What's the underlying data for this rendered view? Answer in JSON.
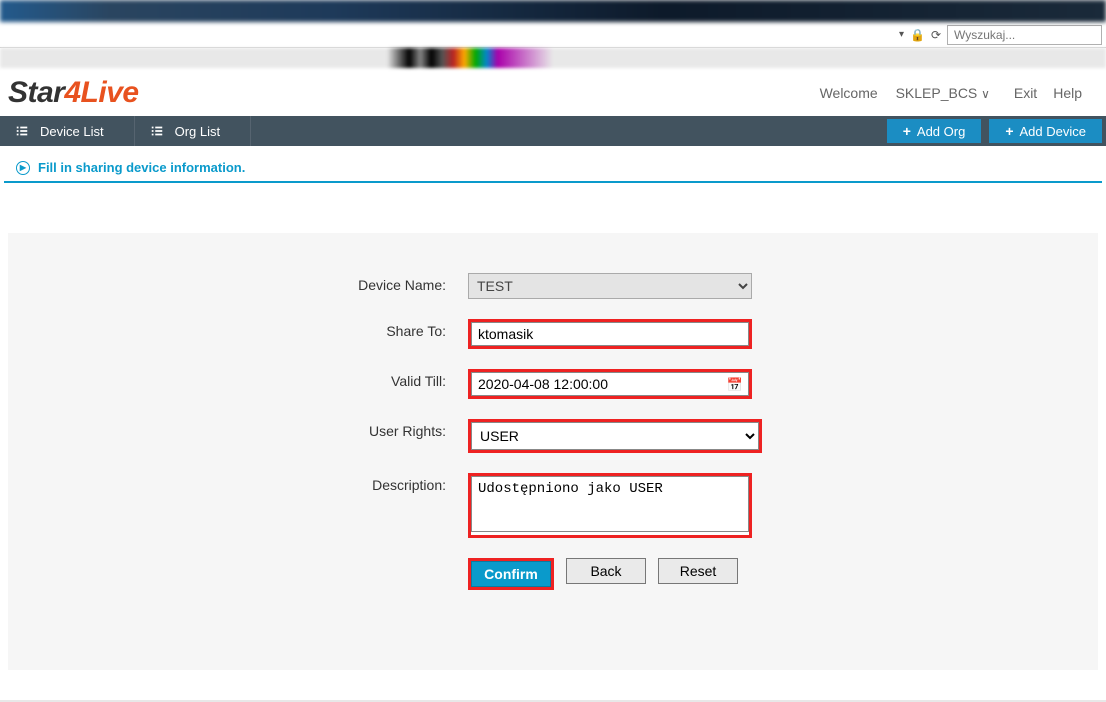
{
  "browser": {
    "search_placeholder": "Wyszukaj..."
  },
  "header": {
    "logo_part1": "Star",
    "logo_part2": "4Live",
    "welcome_label": "Welcome",
    "username": "SKLEP_BCS",
    "exit_label": "Exit",
    "help_label": "Help"
  },
  "nav": {
    "device_list": "Device List",
    "org_list": "Org List",
    "add_org": "Add Org",
    "add_device": "Add Device"
  },
  "section": {
    "title": "Fill in sharing device information."
  },
  "form": {
    "device_name_label": "Device Name:",
    "device_name_value": "TEST",
    "share_to_label": "Share To:",
    "share_to_value": "ktomasik",
    "valid_till_label": "Valid Till:",
    "valid_till_value": "2020-04-08 12:00:00",
    "user_rights_label": "User Rights:",
    "user_rights_value": "USER",
    "description_label": "Description:",
    "description_value": "Udostępniono jako USER",
    "confirm": "Confirm",
    "back": "Back",
    "reset": "Reset"
  }
}
